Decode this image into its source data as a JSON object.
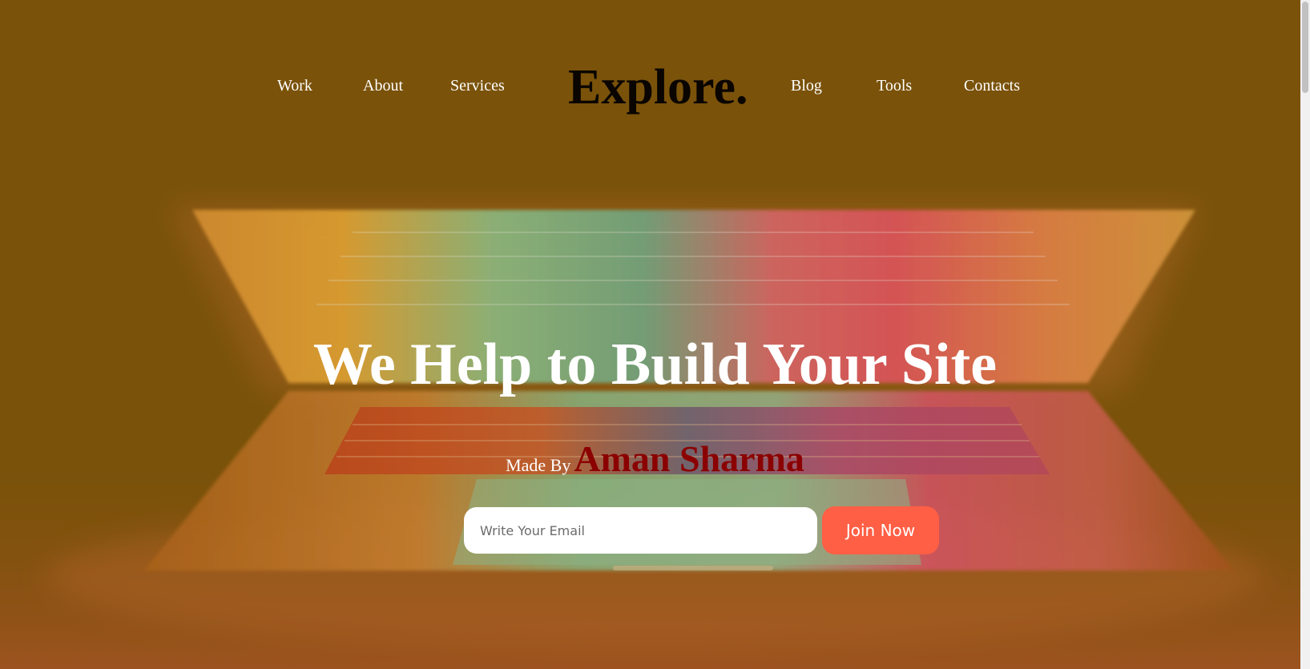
{
  "nav": {
    "left_links": [
      "Work",
      "About",
      "Services"
    ],
    "brand": "Explore.",
    "right_links": [
      "Blog",
      "Tools",
      "Contacts"
    ]
  },
  "hero": {
    "headline": "We Help to Build Your Site",
    "made_by_label": "Made By",
    "author": "Aman Sharma"
  },
  "signup": {
    "email_placeholder": "Write Your Email",
    "email_value": "",
    "join_label": "Join Now"
  },
  "colors": {
    "background": "#7a520a",
    "brand_text": "#0a0500",
    "author_text": "#8b0000",
    "join_button": "#ff5f45"
  },
  "icons": {
    "hero_image": "laptop-image"
  }
}
